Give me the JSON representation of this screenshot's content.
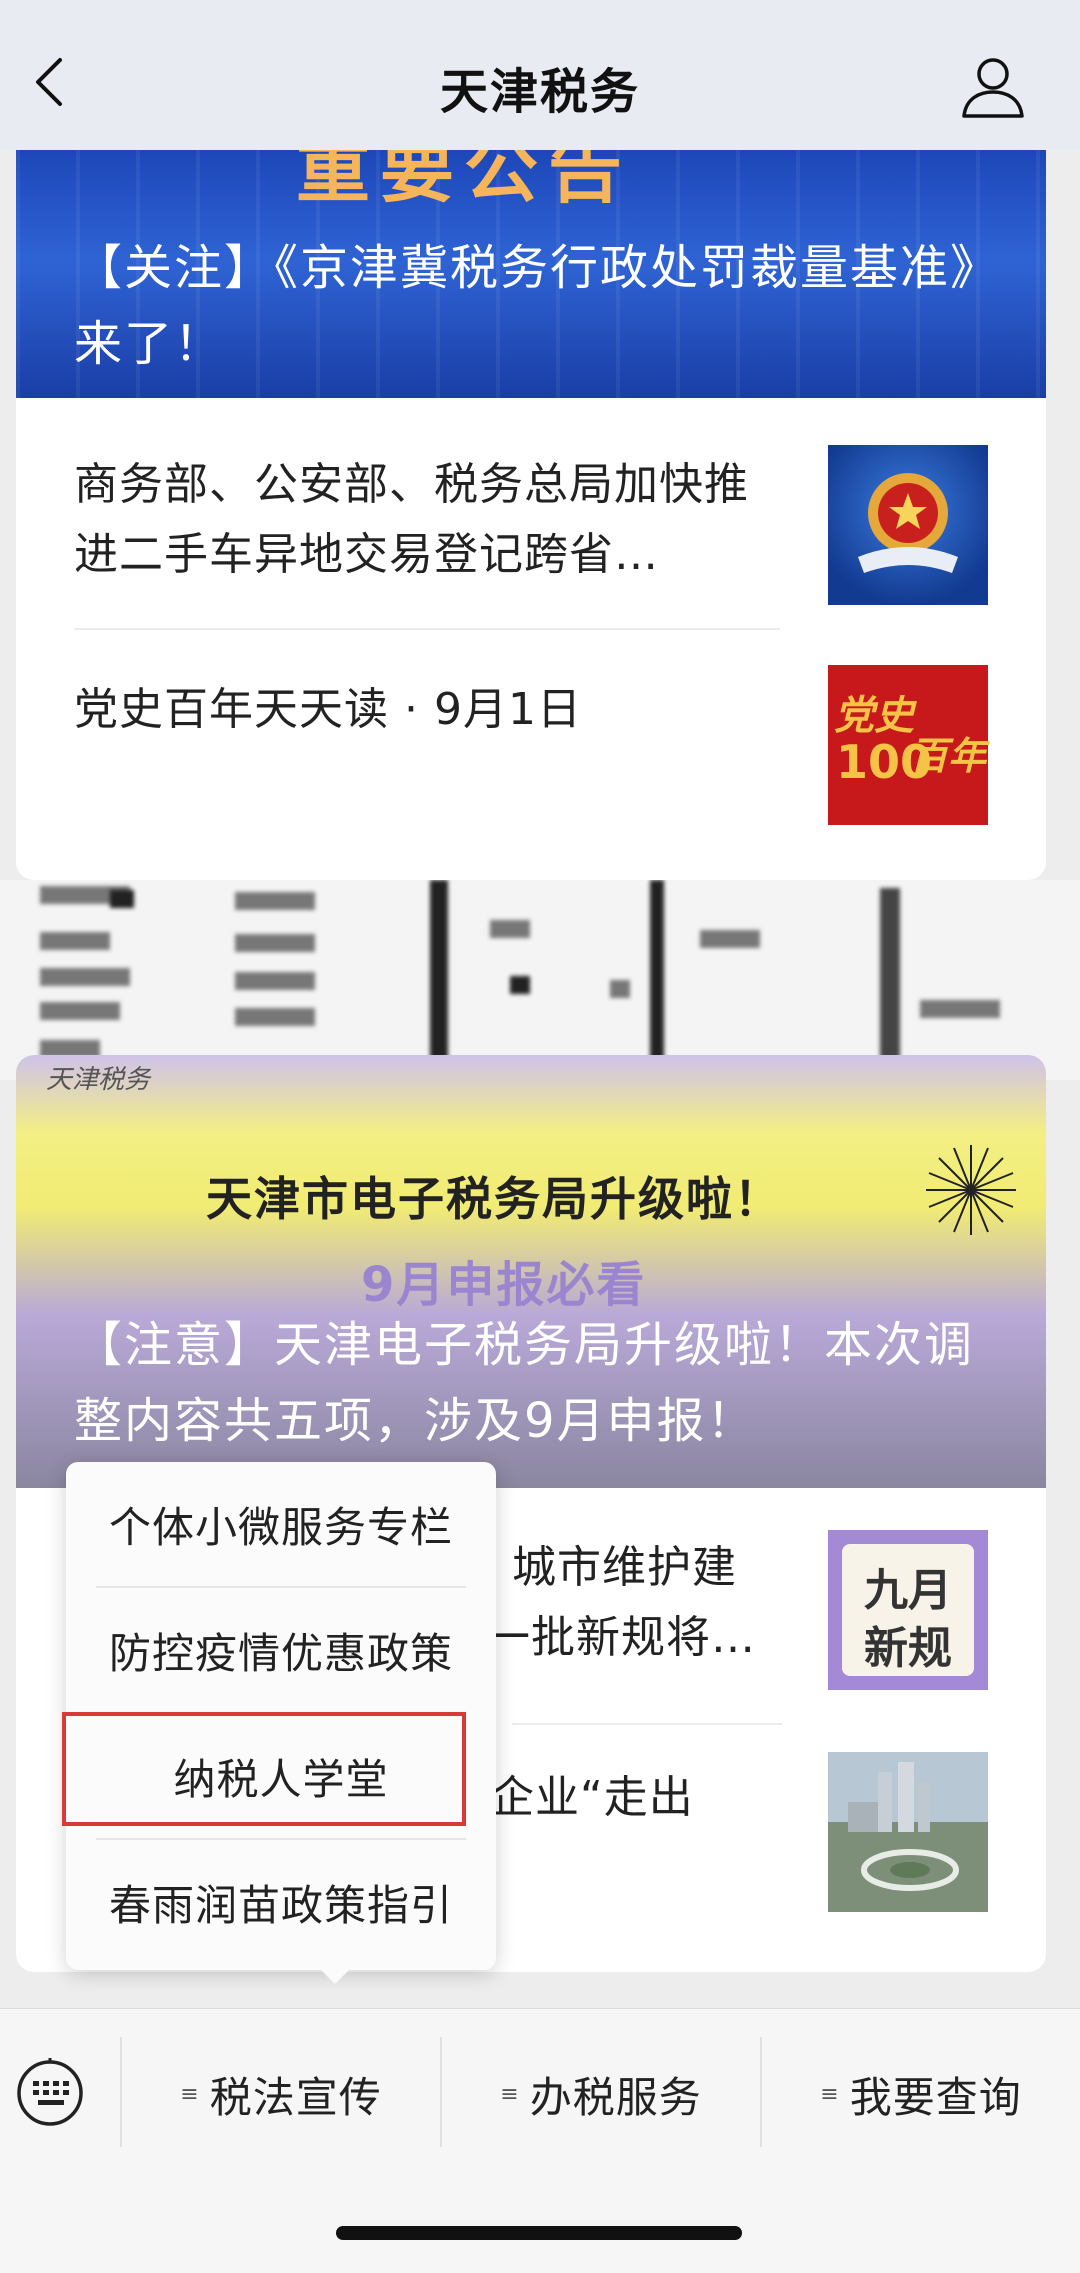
{
  "header": {
    "title": "天津税务",
    "back_icon": "chevron-left-icon",
    "profile_icon": "user-icon"
  },
  "articles_top": {
    "hero_text": "重要公告",
    "hero_headline": "【关注】《京津冀税务行政处罚裁量基准》来了！",
    "items": [
      {
        "title": "商务部、公安部、税务总局加快推进二手车异地交易登记跨省…",
        "thumb": "tax-emblem-image"
      },
      {
        "title": "党史百年天天读 · 9月1日",
        "thumb": "party-history-100-image",
        "thumb_text_1": "党史",
        "thumb_text_2": "100",
        "thumb_text_3": "百年"
      }
    ]
  },
  "articles_bottom": {
    "hero_brand": "天津税务",
    "hero_banner": "天津市电子税务局升级啦！",
    "hero_sub": "9月申报必看",
    "hero_headline": "【注意】天津电子税务局升级啦！本次调整内容共五项，涉及9月申报！",
    "items": [
      {
        "title_visible_1": "城市维护建",
        "title_visible_2": "一批新规将…",
        "thumb": "september-rules-image",
        "thumb_text_1": "九月",
        "thumb_text_2": "新规"
      },
      {
        "title_visible_1": "企业“走出",
        "thumb": "city-aerial-image"
      }
    ]
  },
  "popup_menu": {
    "items": [
      {
        "label": "个体小微服务专栏"
      },
      {
        "label": "防控疫情优惠政策"
      },
      {
        "label": "纳税人学堂"
      },
      {
        "label": "春雨润苗政策指引"
      }
    ],
    "highlighted_index": 2
  },
  "bottom_menu": {
    "keyboard_icon": "keyboard-icon",
    "buttons": [
      {
        "label": "税法宣传"
      },
      {
        "label": "办税服务"
      },
      {
        "label": "我要查询"
      }
    ]
  },
  "colors": {
    "highlight": "#d83a3a",
    "hero_blue": "#2f63d4",
    "hero_yellow": "#f1ec73"
  }
}
